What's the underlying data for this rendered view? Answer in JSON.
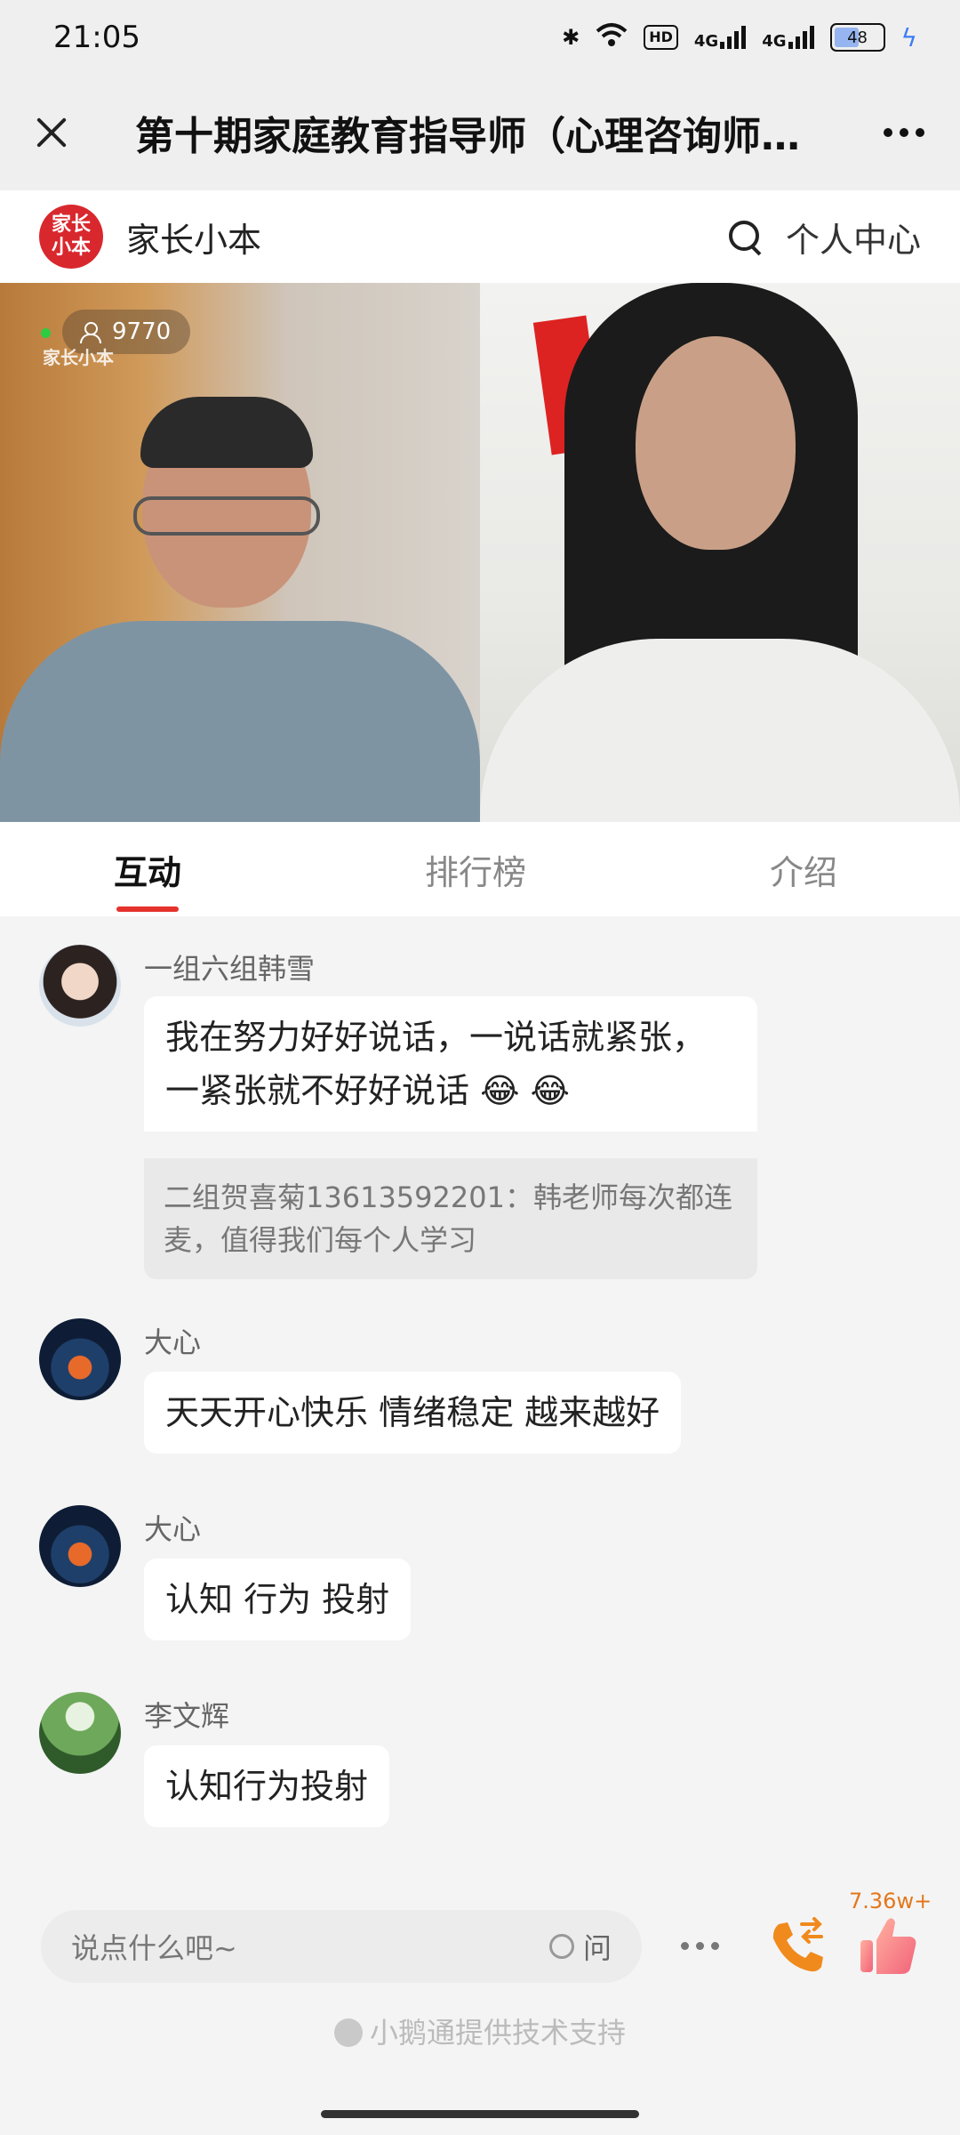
{
  "status": {
    "time": "21:05",
    "hd": "HD",
    "network_1": "4G",
    "network_2": "4G",
    "battery": "48"
  },
  "header": {
    "title": "第十期家庭教育指导师（心理咨询师…"
  },
  "brand": {
    "logo_line1": "家长",
    "logo_line2": "小本",
    "name": "家长小本",
    "personal_center": "个人中心"
  },
  "video": {
    "viewer_count": "9770",
    "watermark": "家长小本"
  },
  "tabs": [
    "互动",
    "排行榜",
    "介绍"
  ],
  "messages": [
    {
      "user": "一组六组韩雪",
      "text_line1": "我在努力好好说话，一说话就紧张，",
      "text_line2": "一紧张就不好好说话 😂 😂",
      "quote_line1": "二组贺喜菊13613592201：韩老师每次都连",
      "quote_line2": "麦，值得我们每个人学习"
    },
    {
      "user": "大心",
      "text": "天天开心快乐 情绪稳定 越来越好"
    },
    {
      "user": "大心",
      "text": "认知 行为 投射"
    },
    {
      "user": "李文辉",
      "text": "认知行为投射"
    }
  ],
  "bottom": {
    "input_placeholder": "说点什么吧~",
    "ask_label": "问",
    "like_count": "7.36w+",
    "support_text": "小鹅通提供技术支持"
  },
  "colors": {
    "accent_red": "#e5322d",
    "brand_red": "#d8282e",
    "like_orange": "#e3771c"
  }
}
